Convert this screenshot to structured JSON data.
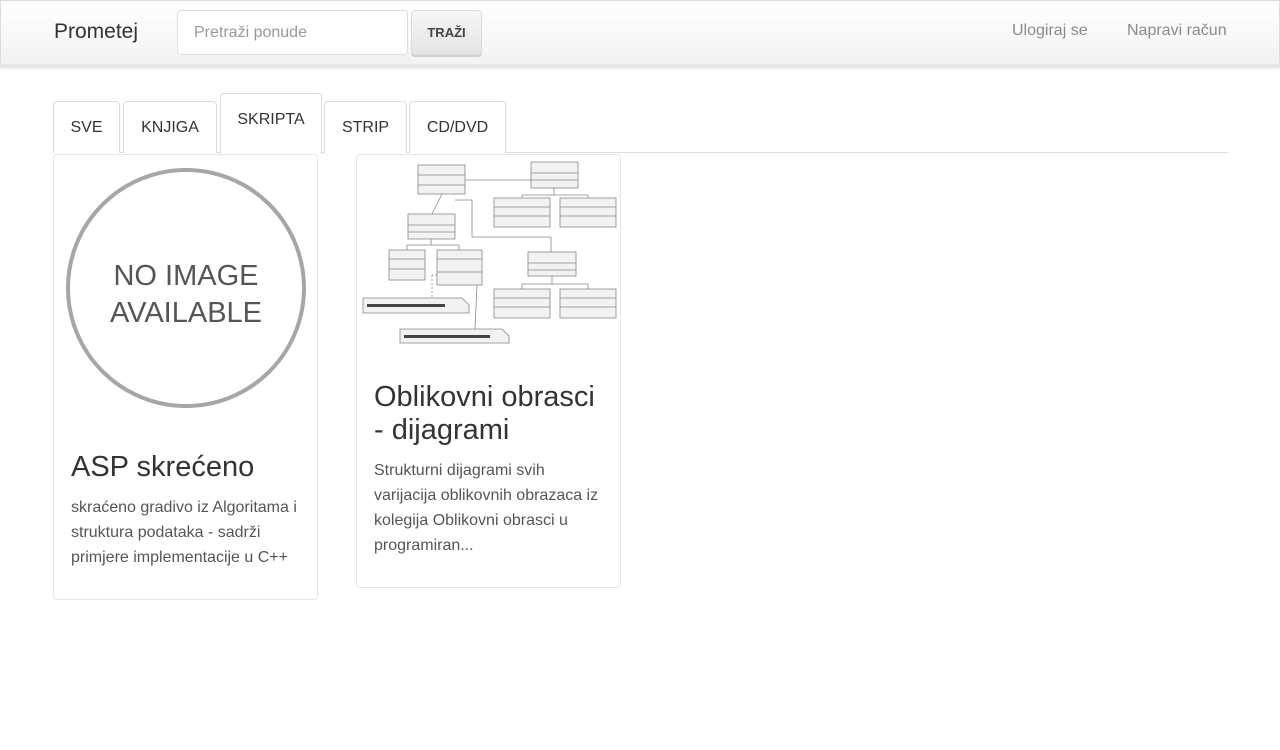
{
  "navbar": {
    "brand": "Prometej",
    "search_placeholder": "Pretraži ponude",
    "search_button": "TRAŽI",
    "login": "Ulogiraj se",
    "register": "Napravi račun"
  },
  "tabs": [
    {
      "label": "SVE",
      "active": false
    },
    {
      "label": "KNJIGA",
      "active": false
    },
    {
      "label": "SKRIPTA",
      "active": true
    },
    {
      "label": "STRIP",
      "active": false
    },
    {
      "label": "CD/DVD",
      "active": false
    }
  ],
  "cards": [
    {
      "image_text_line1": "NO IMAGE",
      "image_text_line2": "AVAILABLE",
      "title": "ASP skrećeno",
      "description": "skraćeno gradivo iz Algoritama i struktura podataka - sadrži primjere implementacije u C++"
    },
    {
      "image": "uml-class-diagram",
      "title": "Oblikovni obrasci - dijagrami",
      "description": "Strukturni dijagrami svih varijacija oblikovnih obrazaca iz kolegija Oblikovni obrasci u programiran..."
    }
  ]
}
